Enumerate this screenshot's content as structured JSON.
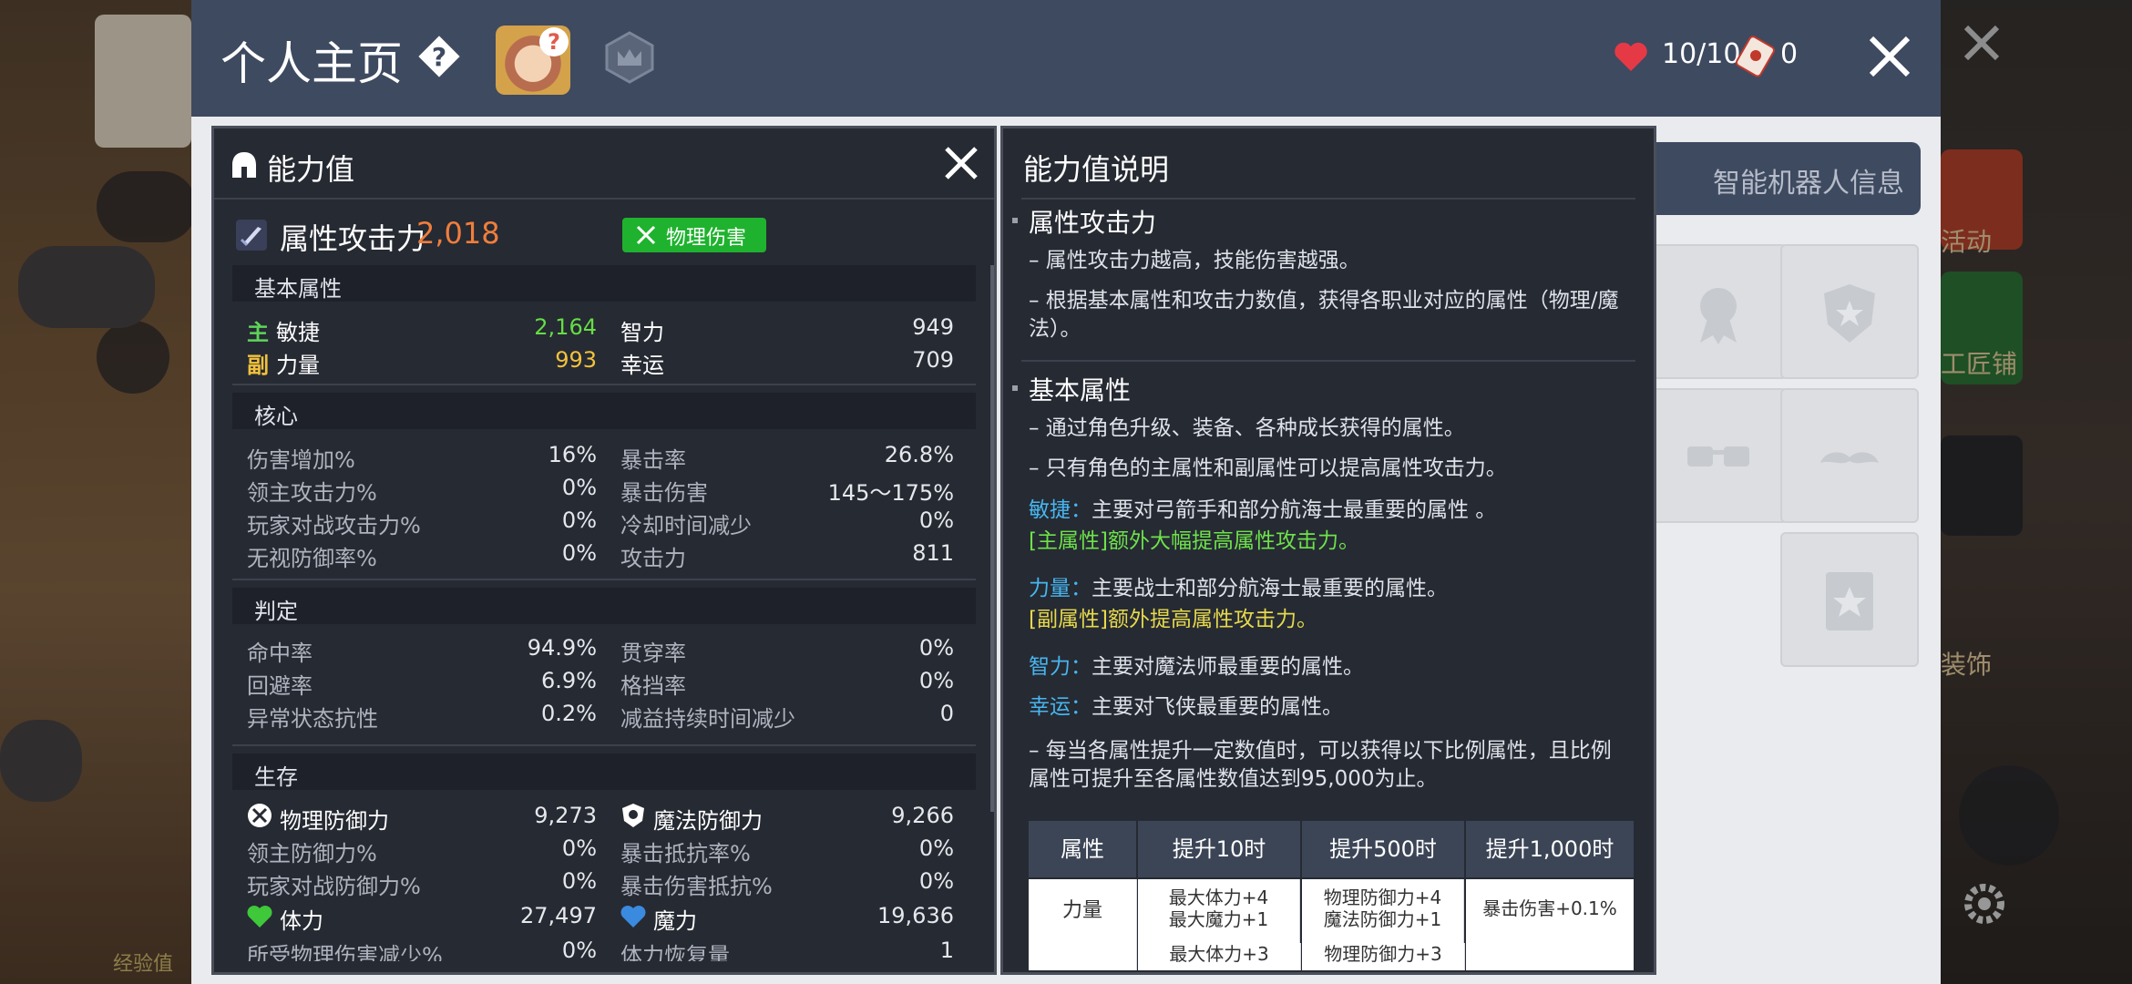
{
  "header": {
    "title": "个人主页",
    "hearts_text": "10/10",
    "tickets_text": "0"
  },
  "robot_tab": {
    "label": "智能机器人信息"
  },
  "left_panel": {
    "title": "能力值",
    "attack": {
      "label": "属性攻击力",
      "value": "2,018",
      "damage_type": "物理伤害"
    },
    "sections": {
      "basic": {
        "title": "基本属性",
        "rows": [
          {
            "tag": "主",
            "label": "敏捷",
            "value": "2,164",
            "r_label": "智力",
            "r_value": "949"
          },
          {
            "tag": "副",
            "label": "力量",
            "value": "993",
            "r_label": "幸运",
            "r_value": "709"
          }
        ]
      },
      "core": {
        "title": "核心",
        "rows": [
          {
            "label": "伤害增加%",
            "value": "16%",
            "r_label": "暴击率",
            "r_value": "26.8%"
          },
          {
            "label": "领主攻击力%",
            "value": "0%",
            "r_label": "暴击伤害",
            "r_value": "145～175%"
          },
          {
            "label": "玩家对战攻击力%",
            "value": "0%",
            "r_label": "冷却时间减少",
            "r_value": "0%"
          },
          {
            "label": "无视防御率%",
            "value": "0%",
            "r_label": "攻击力",
            "r_value": "811"
          }
        ]
      },
      "judge": {
        "title": "判定",
        "rows": [
          {
            "label": "命中率",
            "value": "94.9%",
            "r_label": "贯穿率",
            "r_value": "0%"
          },
          {
            "label": "回避率",
            "value": "6.9%",
            "r_label": "格挡率",
            "r_value": "0%"
          },
          {
            "label": "异常状态抗性",
            "value": "0.2%",
            "r_label": "减益持续时间减少",
            "r_value": "0"
          }
        ]
      },
      "survive": {
        "title": "生存",
        "rows": [
          {
            "label": "物理防御力",
            "value": "9,273",
            "r_label": "魔法防御力",
            "r_value": "9,266"
          },
          {
            "label": "领主防御力%",
            "value": "0%",
            "r_label": "暴击抵抗率%",
            "r_value": "0%"
          },
          {
            "label": "玩家对战防御力%",
            "value": "0%",
            "r_label": "暴击伤害抵抗%",
            "r_value": "0%"
          },
          {
            "label": "体力",
            "value": "27,497",
            "r_label": "魔力",
            "r_value": "19,636"
          },
          {
            "label": "所受物理伤害减少%",
            "value": "0%",
            "r_label": "体力恢复量",
            "r_value": "1"
          }
        ]
      }
    }
  },
  "right_panel": {
    "title": "能力值说明",
    "attack_heading": "属性攻击力",
    "attack_lines": [
      "– 属性攻击力越高，技能伤害越强。",
      "– 根据基本属性和攻击力数值，获得各职业对应的属性（物理/魔法）。"
    ],
    "basic_heading": "基本属性",
    "basic_lines": [
      "– 通过角色升级、装备、各种成长获得的属性。",
      "– 只有角色的主属性和副属性可以提高属性攻击力。"
    ],
    "dex": {
      "name": "敏捷：",
      "desc": "主要对弓箭手和部分航海士最重要的属性 。",
      "note": "[主属性]额外大幅提高属性攻击力。"
    },
    "str": {
      "name": "力量：",
      "desc": "主要战士和部分航海士最重要的属性。",
      "note": "[副属性]额外提高属性攻击力。"
    },
    "int": {
      "name": "智力：",
      "desc": "主要对魔法师最重要的属性。"
    },
    "luk": {
      "name": "幸运：",
      "desc": "主要对飞侠最重要的属性。"
    },
    "bonus_line": "– 每当各属性提升一定数值时，可以获得以下比例属性，且比例属性可提升至各属性数值达到95,000为止。",
    "table": {
      "headers": [
        "属性",
        "提升10时",
        "提升500时",
        "提升1,000时"
      ],
      "row1": {
        "stat": "力量",
        "c1a": "最大体力+4",
        "c1b": "最大魔力+1",
        "c2a": "物理防御力+4",
        "c2b": "魔法防御力+1",
        "c3": "暴击伤害+0.1%"
      },
      "row2": {
        "c1a": "最大体力+3",
        "c2a": "物理防御力+3"
      }
    }
  },
  "background": {
    "left_label": "经验值",
    "right_labels": [
      "活动",
      "工匠铺",
      "装饰"
    ]
  }
}
